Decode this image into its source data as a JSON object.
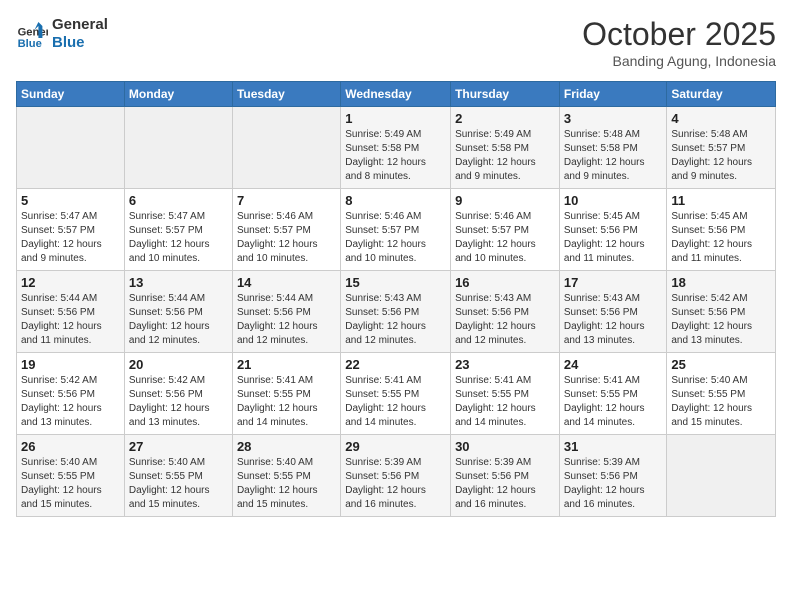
{
  "header": {
    "logo_line1": "General",
    "logo_line2": "Blue",
    "month": "October 2025",
    "location": "Banding Agung, Indonesia"
  },
  "days_of_week": [
    "Sunday",
    "Monday",
    "Tuesday",
    "Wednesday",
    "Thursday",
    "Friday",
    "Saturday"
  ],
  "weeks": [
    [
      {
        "day": "",
        "info": ""
      },
      {
        "day": "",
        "info": ""
      },
      {
        "day": "",
        "info": ""
      },
      {
        "day": "1",
        "info": "Sunrise: 5:49 AM\nSunset: 5:58 PM\nDaylight: 12 hours\nand 8 minutes."
      },
      {
        "day": "2",
        "info": "Sunrise: 5:49 AM\nSunset: 5:58 PM\nDaylight: 12 hours\nand 9 minutes."
      },
      {
        "day": "3",
        "info": "Sunrise: 5:48 AM\nSunset: 5:58 PM\nDaylight: 12 hours\nand 9 minutes."
      },
      {
        "day": "4",
        "info": "Sunrise: 5:48 AM\nSunset: 5:57 PM\nDaylight: 12 hours\nand 9 minutes."
      }
    ],
    [
      {
        "day": "5",
        "info": "Sunrise: 5:47 AM\nSunset: 5:57 PM\nDaylight: 12 hours\nand 9 minutes."
      },
      {
        "day": "6",
        "info": "Sunrise: 5:47 AM\nSunset: 5:57 PM\nDaylight: 12 hours\nand 10 minutes."
      },
      {
        "day": "7",
        "info": "Sunrise: 5:46 AM\nSunset: 5:57 PM\nDaylight: 12 hours\nand 10 minutes."
      },
      {
        "day": "8",
        "info": "Sunrise: 5:46 AM\nSunset: 5:57 PM\nDaylight: 12 hours\nand 10 minutes."
      },
      {
        "day": "9",
        "info": "Sunrise: 5:46 AM\nSunset: 5:57 PM\nDaylight: 12 hours\nand 10 minutes."
      },
      {
        "day": "10",
        "info": "Sunrise: 5:45 AM\nSunset: 5:56 PM\nDaylight: 12 hours\nand 11 minutes."
      },
      {
        "day": "11",
        "info": "Sunrise: 5:45 AM\nSunset: 5:56 PM\nDaylight: 12 hours\nand 11 minutes."
      }
    ],
    [
      {
        "day": "12",
        "info": "Sunrise: 5:44 AM\nSunset: 5:56 PM\nDaylight: 12 hours\nand 11 minutes."
      },
      {
        "day": "13",
        "info": "Sunrise: 5:44 AM\nSunset: 5:56 PM\nDaylight: 12 hours\nand 12 minutes."
      },
      {
        "day": "14",
        "info": "Sunrise: 5:44 AM\nSunset: 5:56 PM\nDaylight: 12 hours\nand 12 minutes."
      },
      {
        "day": "15",
        "info": "Sunrise: 5:43 AM\nSunset: 5:56 PM\nDaylight: 12 hours\nand 12 minutes."
      },
      {
        "day": "16",
        "info": "Sunrise: 5:43 AM\nSunset: 5:56 PM\nDaylight: 12 hours\nand 12 minutes."
      },
      {
        "day": "17",
        "info": "Sunrise: 5:43 AM\nSunset: 5:56 PM\nDaylight: 12 hours\nand 13 minutes."
      },
      {
        "day": "18",
        "info": "Sunrise: 5:42 AM\nSunset: 5:56 PM\nDaylight: 12 hours\nand 13 minutes."
      }
    ],
    [
      {
        "day": "19",
        "info": "Sunrise: 5:42 AM\nSunset: 5:56 PM\nDaylight: 12 hours\nand 13 minutes."
      },
      {
        "day": "20",
        "info": "Sunrise: 5:42 AM\nSunset: 5:56 PM\nDaylight: 12 hours\nand 13 minutes."
      },
      {
        "day": "21",
        "info": "Sunrise: 5:41 AM\nSunset: 5:55 PM\nDaylight: 12 hours\nand 14 minutes."
      },
      {
        "day": "22",
        "info": "Sunrise: 5:41 AM\nSunset: 5:55 PM\nDaylight: 12 hours\nand 14 minutes."
      },
      {
        "day": "23",
        "info": "Sunrise: 5:41 AM\nSunset: 5:55 PM\nDaylight: 12 hours\nand 14 minutes."
      },
      {
        "day": "24",
        "info": "Sunrise: 5:41 AM\nSunset: 5:55 PM\nDaylight: 12 hours\nand 14 minutes."
      },
      {
        "day": "25",
        "info": "Sunrise: 5:40 AM\nSunset: 5:55 PM\nDaylight: 12 hours\nand 15 minutes."
      }
    ],
    [
      {
        "day": "26",
        "info": "Sunrise: 5:40 AM\nSunset: 5:55 PM\nDaylight: 12 hours\nand 15 minutes."
      },
      {
        "day": "27",
        "info": "Sunrise: 5:40 AM\nSunset: 5:55 PM\nDaylight: 12 hours\nand 15 minutes."
      },
      {
        "day": "28",
        "info": "Sunrise: 5:40 AM\nSunset: 5:55 PM\nDaylight: 12 hours\nand 15 minutes."
      },
      {
        "day": "29",
        "info": "Sunrise: 5:39 AM\nSunset: 5:56 PM\nDaylight: 12 hours\nand 16 minutes."
      },
      {
        "day": "30",
        "info": "Sunrise: 5:39 AM\nSunset: 5:56 PM\nDaylight: 12 hours\nand 16 minutes."
      },
      {
        "day": "31",
        "info": "Sunrise: 5:39 AM\nSunset: 5:56 PM\nDaylight: 12 hours\nand 16 minutes."
      },
      {
        "day": "",
        "info": ""
      }
    ]
  ]
}
